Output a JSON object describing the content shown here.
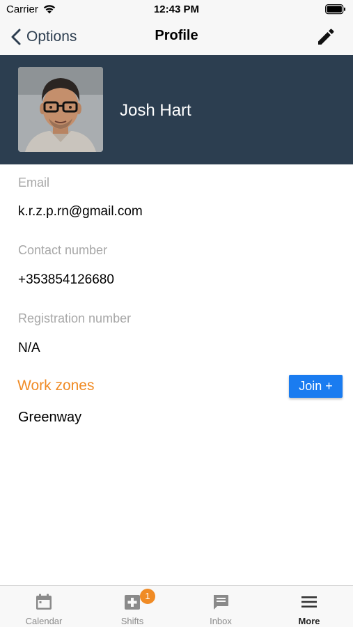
{
  "status_bar": {
    "carrier": "Carrier",
    "time": "12:43 PM"
  },
  "nav": {
    "back_label": "Options",
    "title": "Profile",
    "edit_icon": "pencil-icon"
  },
  "profile": {
    "name": "Josh Hart",
    "header_color": "#2c3e50"
  },
  "fields": [
    {
      "label": "Email",
      "value": "k.r.z.p.rn@gmail.com"
    },
    {
      "label": "Contact number",
      "value": "+353854126680"
    },
    {
      "label": "Registration number",
      "value": "N/A"
    }
  ],
  "work_zones": {
    "title": "Work zones",
    "join_label": "Join +",
    "items": [
      "Greenway"
    ],
    "accent_color": "#f08b25",
    "button_color": "#1a7cf0"
  },
  "tab_bar": {
    "tabs": [
      {
        "label": "Calendar",
        "icon": "calendar-icon",
        "active": false
      },
      {
        "label": "Shifts",
        "icon": "shifts-plus-icon",
        "active": false,
        "badge": "1"
      },
      {
        "label": "Inbox",
        "icon": "inbox-icon",
        "active": false
      },
      {
        "label": "More",
        "icon": "menu-icon",
        "active": true
      }
    ]
  }
}
